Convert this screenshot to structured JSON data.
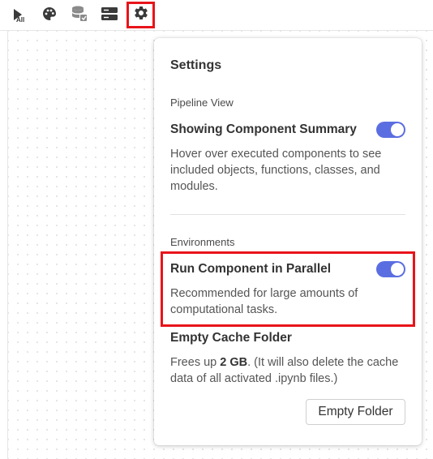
{
  "toolbar": {
    "buttons": [
      {
        "name": "run-all",
        "icon": "play-icon",
        "label": "All"
      },
      {
        "name": "theme",
        "icon": "palette-icon"
      },
      {
        "name": "data",
        "icon": "database-icon"
      },
      {
        "name": "server",
        "icon": "server-icon"
      },
      {
        "name": "settings",
        "icon": "gear-icon",
        "active": true
      }
    ]
  },
  "settings": {
    "title": "Settings",
    "pipeline_view": {
      "section_label": "Pipeline View",
      "option_title": "Showing Component Summary",
      "option_enabled": true,
      "description": "Hover over executed components to see included objects, functions, classes, and modules."
    },
    "environments": {
      "section_label": "Environments",
      "option_title": "Run Component in Parallel",
      "option_enabled": true,
      "description": "Recommended for large amounts of computational tasks."
    },
    "cache": {
      "title": "Empty Cache Folder",
      "desc_prefix": "Frees up ",
      "size": "2 GB",
      "desc_suffix": ". (It will also delete the cache data of all activated .ipynb files.)",
      "button_label": "Empty Folder"
    }
  },
  "colors": {
    "accent": "#5b6ee1",
    "highlight": "#e8141a",
    "icon": "#3a3a3a"
  }
}
